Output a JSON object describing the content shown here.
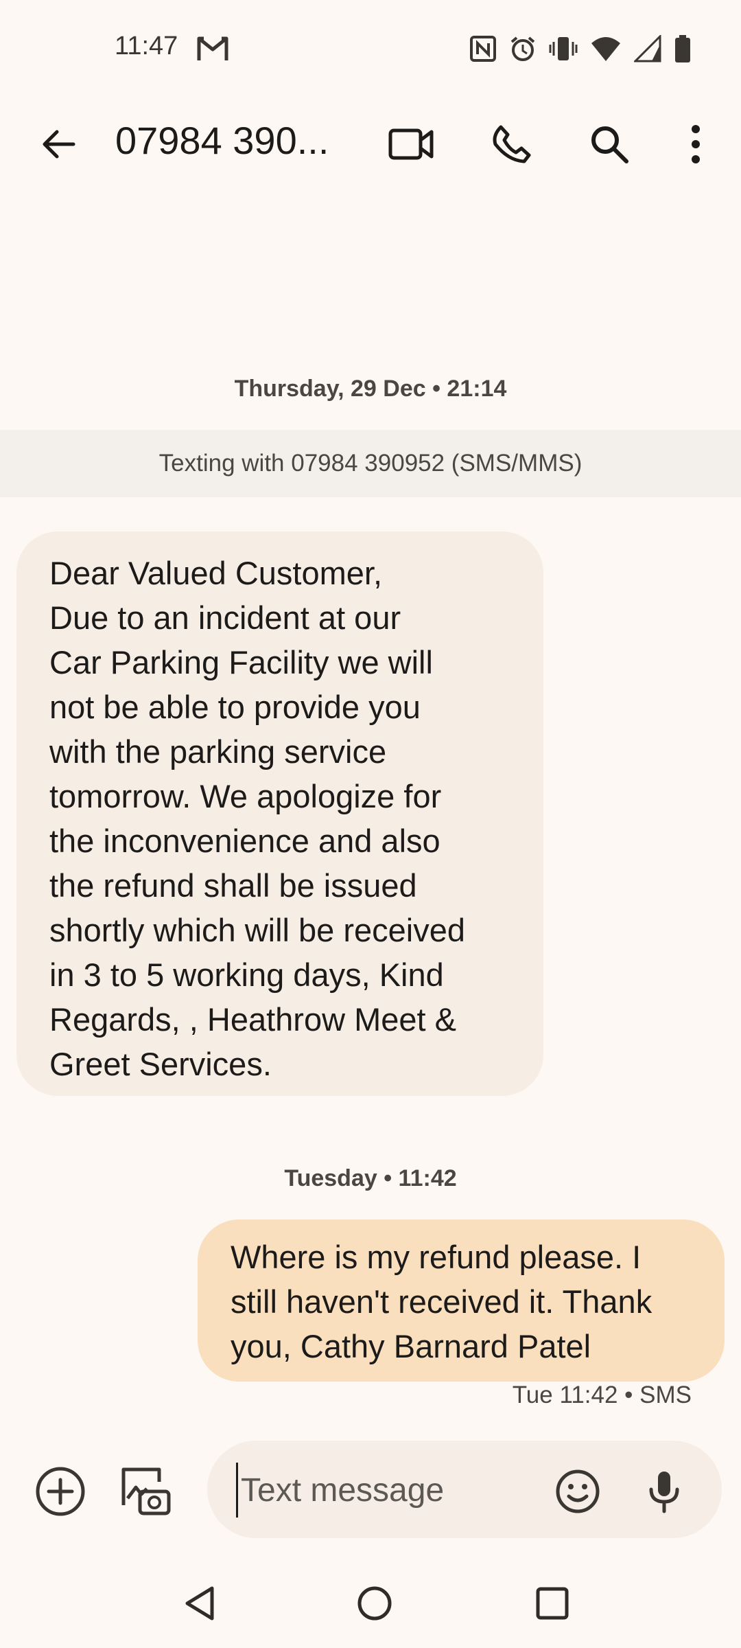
{
  "status_bar": {
    "time": "11:47",
    "icons": [
      "gmail-icon",
      "nfc-icon",
      "alarm-icon",
      "vibrate-icon",
      "wifi-icon",
      "signal-icon",
      "battery-icon"
    ]
  },
  "app_bar": {
    "title": "07984 390...",
    "icons": [
      "back-arrow-icon",
      "video-call-icon",
      "phone-icon",
      "search-icon",
      "more-vert-icon"
    ]
  },
  "conversation": {
    "date_header_1": "Thursday, 29 Dec • 21:14",
    "banner": "Texting with 07984 390952 (SMS/MMS)",
    "incoming_message": "Dear Valued Customer,\nDue to an incident at our\nCar Parking Facility we will\nnot be able to provide you\nwith the parking service\ntomorrow. We apologize for\nthe inconvenience and also\nthe refund shall be issued\nshortly which will be received\nin 3 to 5 working days, Kind\nRegards, , Heathrow Meet &\nGreet Services.",
    "date_header_2": "Tuesday • 11:42",
    "outgoing_message": "Where is my refund please. I\nstill haven't received it. Thank\nyou, Cathy Barnard Patel",
    "outgoing_meta": "Tue 11:42 • SMS"
  },
  "composer": {
    "placeholder": "Text message",
    "icons": [
      "add-circle-icon",
      "gallery-camera-icon",
      "emoji-icon",
      "mic-icon"
    ]
  },
  "nav_bar": {
    "icons": [
      "nav-back-icon",
      "nav-home-icon",
      "nav-recents-icon"
    ]
  },
  "colors": {
    "background": "#fdf8f4",
    "incoming_bubble": "#f6ede5",
    "outgoing_bubble": "#fadfbe",
    "banner": "#f3efea",
    "composer": "#f5ede6"
  }
}
